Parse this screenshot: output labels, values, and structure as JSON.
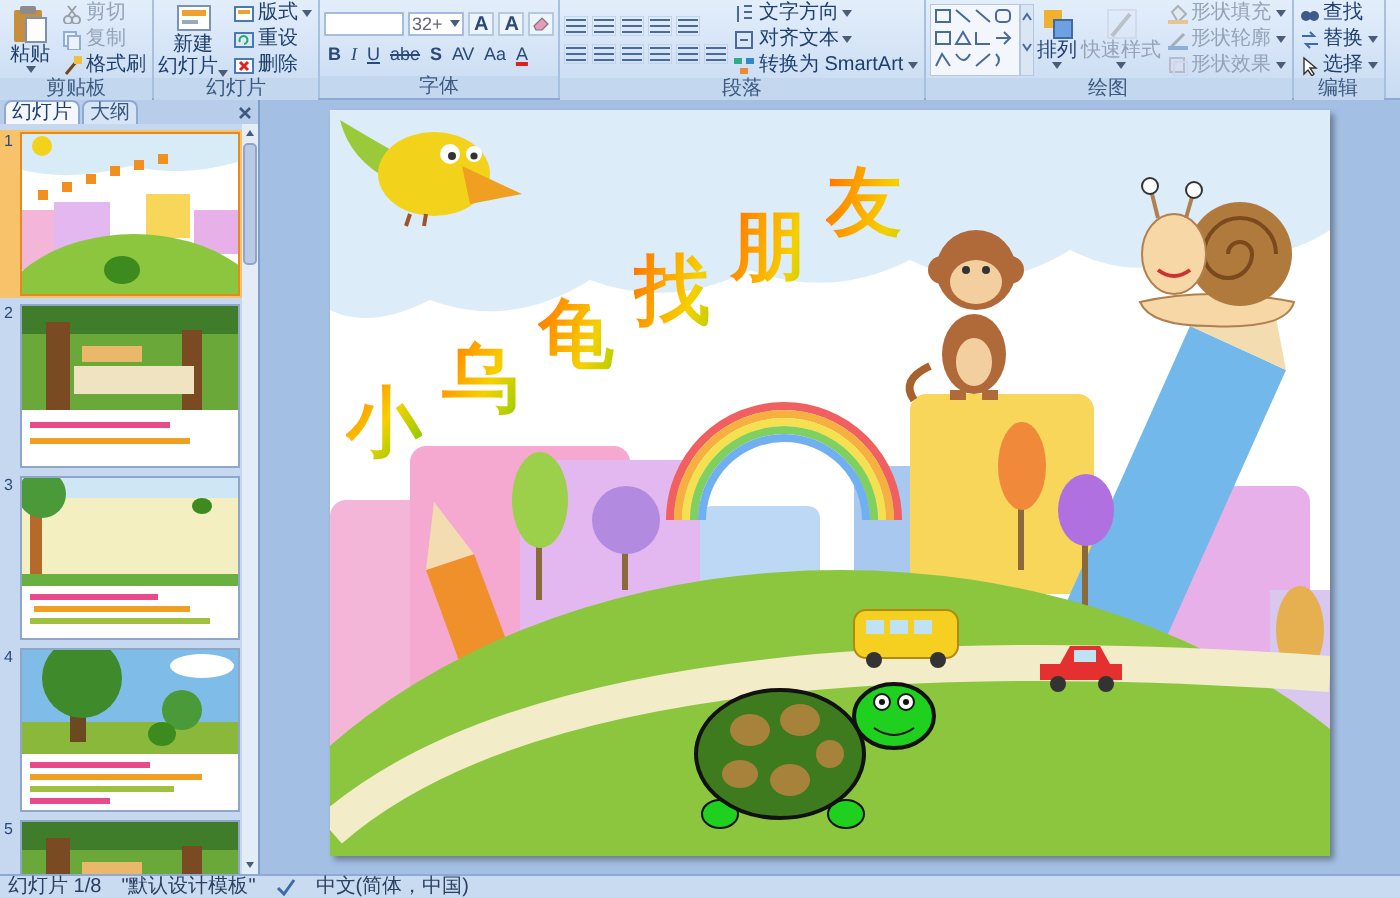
{
  "ribbon": {
    "clipboard": {
      "group_label": "剪贴板",
      "paste": "粘贴",
      "items": [
        {
          "label": "剪切",
          "disabled": true
        },
        {
          "label": "复制",
          "disabled": true
        },
        {
          "label": "格式刷",
          "disabled": false
        }
      ]
    },
    "slides": {
      "group_label": "幻灯片",
      "new_slide": [
        "新建",
        "幻灯片"
      ],
      "items": [
        {
          "label": "版式",
          "has_menu": true
        },
        {
          "label": "重设",
          "has_menu": false
        },
        {
          "label": "删除",
          "has_menu": false
        }
      ]
    },
    "font": {
      "group_label": "字体",
      "size": "32+",
      "row_1": [
        "A",
        "A"
      ],
      "row_2": [
        "B",
        "I",
        "U",
        "abe",
        "S",
        "AV",
        "Aa",
        "A"
      ]
    },
    "paragraph": {
      "group_label": "段落",
      "commands": [
        {
          "label": "文字方向",
          "has_menu": true
        },
        {
          "label": "对齐文本",
          "has_menu": true
        },
        {
          "label": "转换为 SmartArt",
          "has_menu": true
        }
      ]
    },
    "drawing": {
      "group_label": "绘图",
      "arrange": "排列",
      "quick_styles": {
        "label": "快速样式",
        "disabled": true
      },
      "commands": [
        {
          "label": "形状填充",
          "disabled": true,
          "has_menu": true
        },
        {
          "label": "形状轮廓",
          "disabled": true,
          "has_menu": true
        },
        {
          "label": "形状效果",
          "disabled": true,
          "has_menu": true
        }
      ]
    },
    "editing": {
      "group_label": "编辑",
      "commands": [
        {
          "label": "查找",
          "has_menu": false
        },
        {
          "label": "替换",
          "has_menu": true
        },
        {
          "label": "选择",
          "has_menu": true
        }
      ]
    }
  },
  "pane": {
    "tabs": [
      {
        "label": "幻灯片",
        "selected": true
      },
      {
        "label": "大纲",
        "selected": false
      }
    ],
    "thumbnails": [
      {
        "number": "1",
        "kind": "title_scene",
        "selected": true
      },
      {
        "number": "2",
        "kind": "forest_scene",
        "selected": false
      },
      {
        "number": "3",
        "kind": "meadow_scene",
        "selected": false
      },
      {
        "number": "4",
        "kind": "tree_scene",
        "selected": false
      },
      {
        "number": "5",
        "kind": "forest_scene",
        "selected": false
      }
    ]
  },
  "slide": {
    "title": "小乌龟找朋友"
  },
  "status_bar": {
    "slide_position": "幻灯片 1/8",
    "theme": "\"默认设计模板\"",
    "language": "中文(简体，中国)"
  }
}
